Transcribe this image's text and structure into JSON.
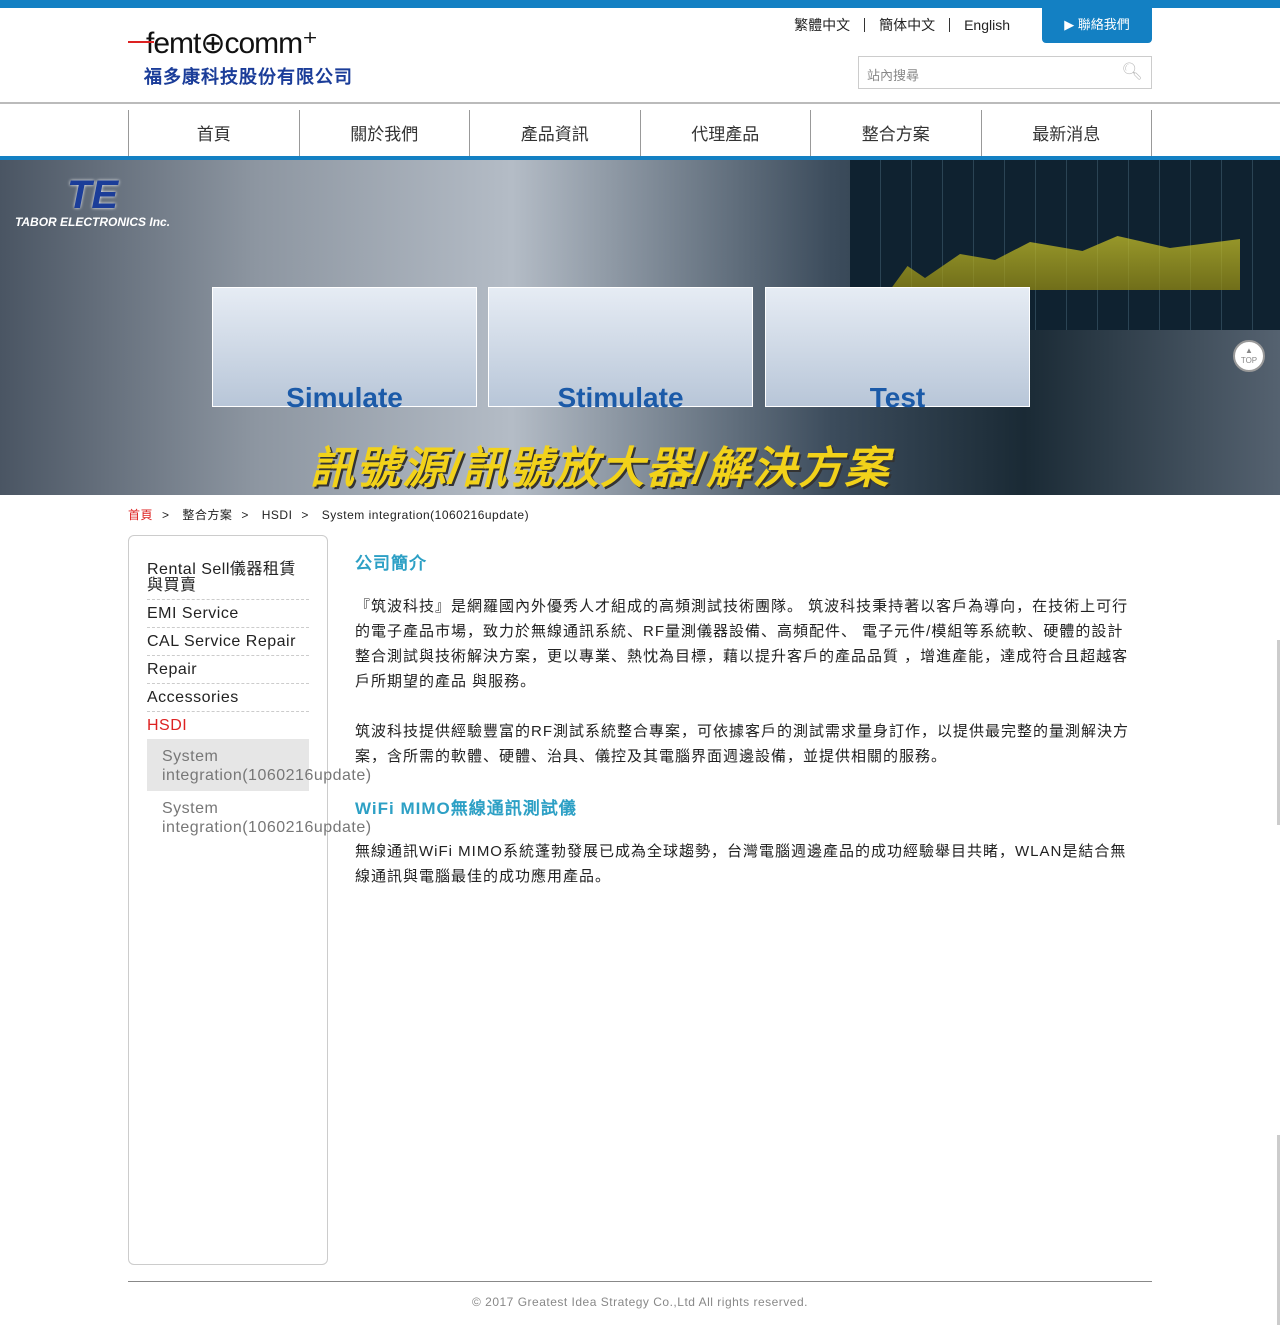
{
  "brand": {
    "logo_en": "femt⊕comm⁺",
    "logo_zh": "福多康科技股份有限公司"
  },
  "header": {
    "langs": [
      "繁體中文",
      "簡体中文",
      "English"
    ],
    "contact": "▶ 聯絡我們",
    "search_placeholder": "站內搜尋"
  },
  "nav": [
    "首頁",
    "關於我們",
    "產品資訊",
    "代理產品",
    "整合方案",
    "最新消息"
  ],
  "banner": {
    "brand": "TABOR ELECTRONICS Inc.",
    "panels": [
      "Simulate",
      "Stimulate",
      "Test"
    ],
    "caption": "訊號源/訊號放大器/解決方案",
    "top": "TOP"
  },
  "breadcrumb": [
    "首頁",
    "整合方案",
    "HSDI",
    "System integration(1060216update)"
  ],
  "sidebar": {
    "items": [
      "Rental Sell儀器租賃與買賣",
      "EMI Service",
      "CAL Service Repair",
      "Repair",
      "Accessories",
      "HSDI"
    ],
    "subs": [
      "System integration(1060216update)",
      "System integration(1060216update)"
    ]
  },
  "content": {
    "h1": "公司簡介",
    "p1": "『筑波科技』是網羅國內外優秀人才組成的高頻測試技術團隊。 筑波科技秉持著以客戶為導向，在技術上可行的電子產品市場，致力於無線通訊系統、RF量測儀器設備、高頻配件、 電子元件/模組等系統軟、硬體的設計整合測試與技術解決方案，更以專業、熱忱為目標，藉以提升客戶的產品品質 ，增進產能，達成符合且超越客戶所期望的產品 與服務。",
    "p2": "筑波科技提供經驗豐富的RF測試系統整合專案，可依據客戶的測試需求量身訂作，以提供最完整的量測解決方案，含所需的軟體、硬體、治具、儀控及其電腦界面週邊設備，並提供相關的服務。",
    "h2": "WiFi MIMO無線通訊測試儀",
    "p3": "無線通訊WiFi MIMO系統蓬勃發展已成為全球趨勢，台灣電腦週邊產品的成功經驗舉目共睹，WLAN是結合無線通訊與電腦最佳的成功應用產品。"
  },
  "footer": "© 2017 Greatest Idea Strategy Co.,Ltd All rights reserved."
}
